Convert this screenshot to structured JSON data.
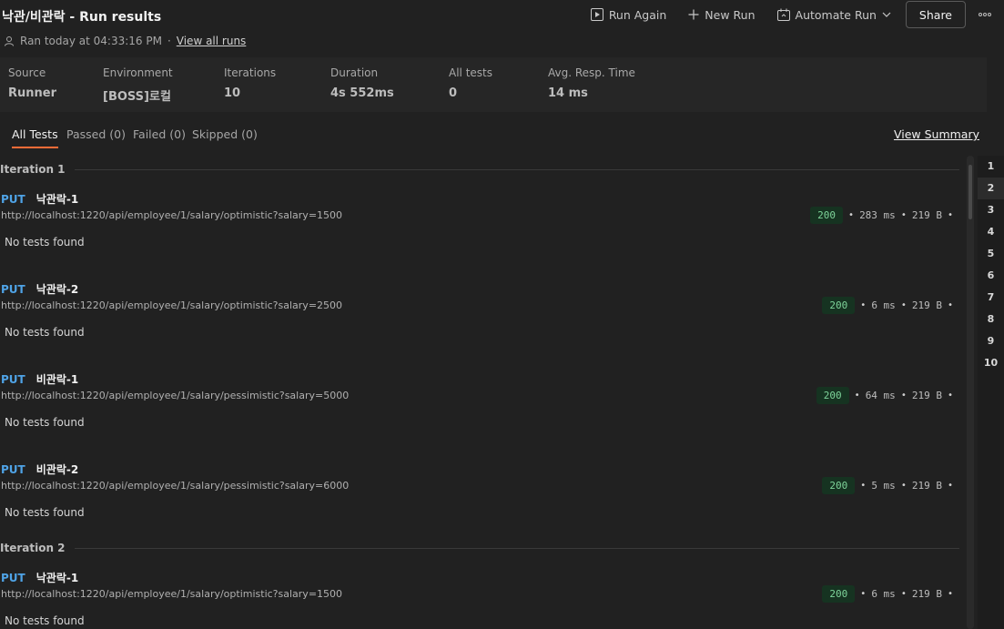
{
  "header": {
    "title": "낙관/비관락 - Run results",
    "ran_text": "Ran today at 04:33:16 PM",
    "separator": "·",
    "view_all_runs": "View all runs",
    "run_again": "Run Again",
    "new_run": "New Run",
    "automate_run": "Automate Run",
    "share": "Share"
  },
  "stats": [
    {
      "label": "Source",
      "value": "Runner"
    },
    {
      "label": "Environment",
      "value": "[BOSS]로컬"
    },
    {
      "label": "Iterations",
      "value": "10"
    },
    {
      "label": "Duration",
      "value": "4s 552ms"
    },
    {
      "label": "All tests",
      "value": "0"
    },
    {
      "label": "Avg. Resp. Time",
      "value": "14 ms"
    }
  ],
  "tabs": [
    {
      "label": "All Tests",
      "active": true
    },
    {
      "label": "Passed (0)"
    },
    {
      "label": "Failed (0)"
    },
    {
      "label": "Skipped (0)"
    }
  ],
  "view_summary": "View Summary",
  "iterations": [
    {
      "label": "Iteration 1",
      "requests": [
        {
          "method": "PUT",
          "name": "낙관락-1",
          "url": "http://localhost:1220/api/employee/1/salary/optimistic?salary=1500",
          "status": "200",
          "time": "283 ms",
          "size": "219 B",
          "tests": "No tests found"
        },
        {
          "method": "PUT",
          "name": "낙관락-2",
          "url": "http://localhost:1220/api/employee/1/salary/optimistic?salary=2500",
          "status": "200",
          "time": "6 ms",
          "size": "219 B",
          "tests": "No tests found"
        },
        {
          "method": "PUT",
          "name": "비관락-1",
          "url": "http://localhost:1220/api/employee/1/salary/pessimistic?salary=5000",
          "status": "200",
          "time": "64 ms",
          "size": "219 B",
          "tests": "No tests found"
        },
        {
          "method": "PUT",
          "name": "비관락-2",
          "url": "http://localhost:1220/api/employee/1/salary/pessimistic?salary=6000",
          "status": "200",
          "time": "5 ms",
          "size": "219 B",
          "tests": "No tests found"
        }
      ]
    },
    {
      "label": "Iteration 2",
      "requests": [
        {
          "method": "PUT",
          "name": "낙관락-1",
          "url": "http://localhost:1220/api/employee/1/salary/optimistic?salary=1500",
          "status": "200",
          "time": "6 ms",
          "size": "219 B",
          "tests": "No tests found"
        }
      ]
    }
  ],
  "iteration_nav": [
    "1",
    "2",
    "3",
    "4",
    "5",
    "6",
    "7",
    "8",
    "9",
    "10"
  ],
  "iteration_nav_active": 1,
  "colors": {
    "accent": "#ff6c37",
    "method_put": "#4fa3e6",
    "status_ok_bg": "#163321",
    "status_ok_text": "#7ed49a"
  }
}
